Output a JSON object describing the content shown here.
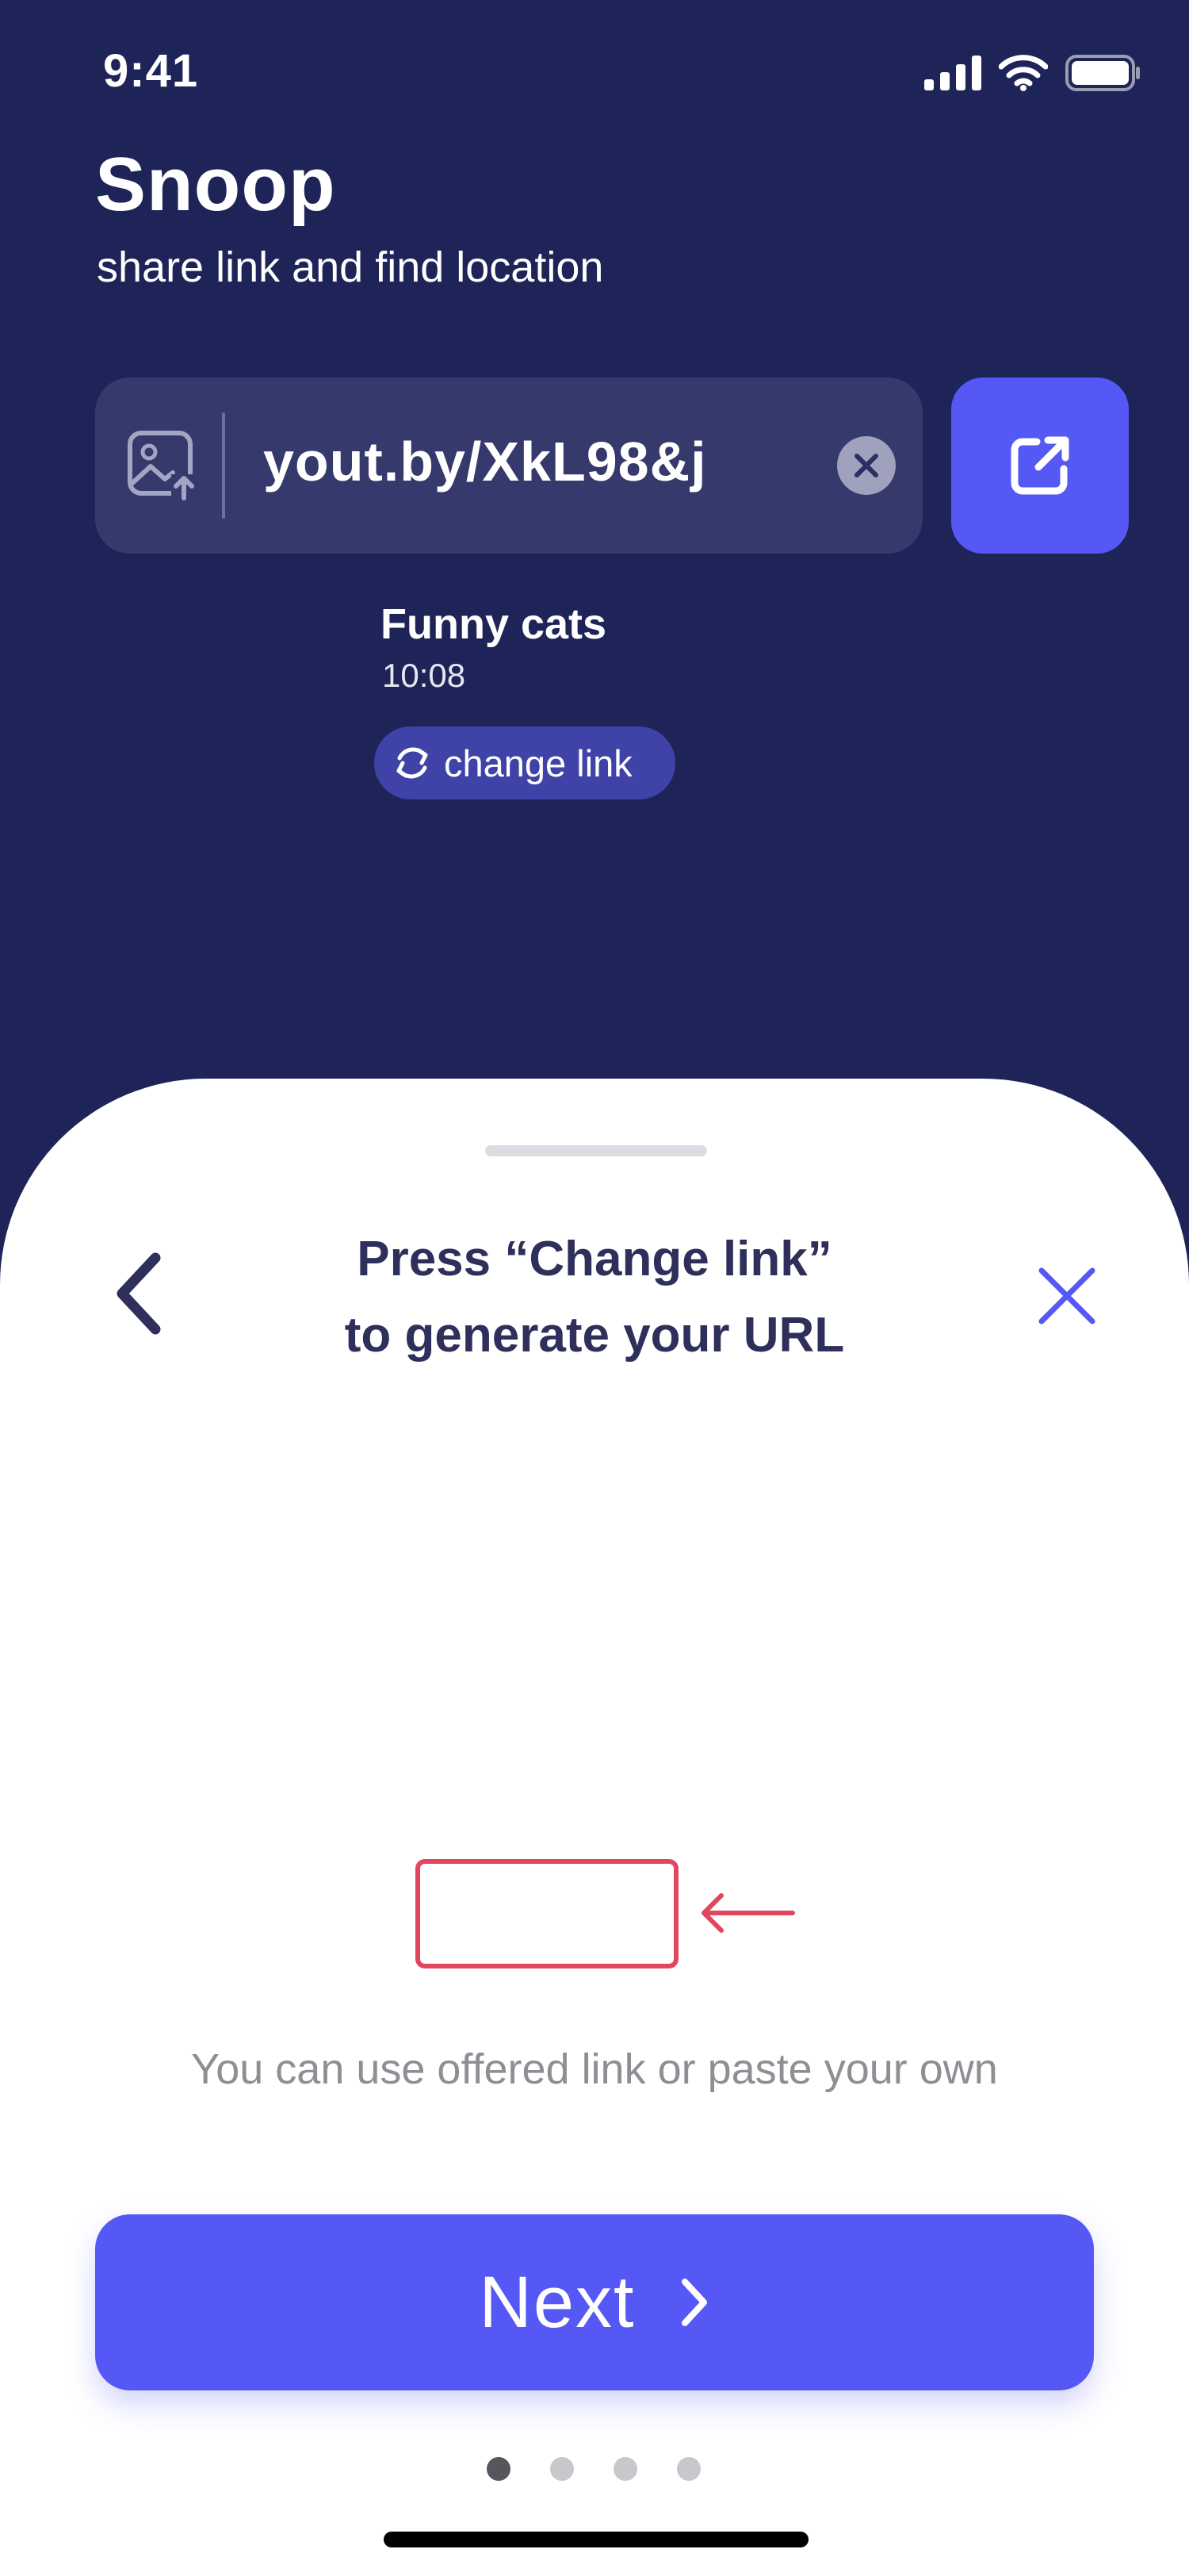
{
  "status_bar": {
    "time": "9:41",
    "icons": [
      "cellular-signal-icon",
      "wifi-icon",
      "battery-icon"
    ]
  },
  "header": {
    "title": "Snoop",
    "subtitle": "share link and find location"
  },
  "link_field": {
    "value": "yout.by/XkL98&j",
    "leading_icon": "image-upload-icon",
    "clear_icon": "clear-icon"
  },
  "open_link_button": {
    "icon": "external-link-icon"
  },
  "video": {
    "title": "Funny cats",
    "time": "10:08"
  },
  "change_link": {
    "label": "change link",
    "icon": "refresh-icon"
  },
  "onboarding_sheet": {
    "title_line1": "Press “Change link”",
    "title_line2": "to generate your URL",
    "hint": "You can use offered link or paste your own",
    "next_label": "Next",
    "page_count": 4,
    "current_page": 1
  },
  "colors": {
    "background": "#1f2458",
    "field": "#35396c",
    "accent": "#5558f5",
    "chip": "#3f43a8",
    "highlight": "#e0475f",
    "sheet_title": "#2f2f5c"
  }
}
